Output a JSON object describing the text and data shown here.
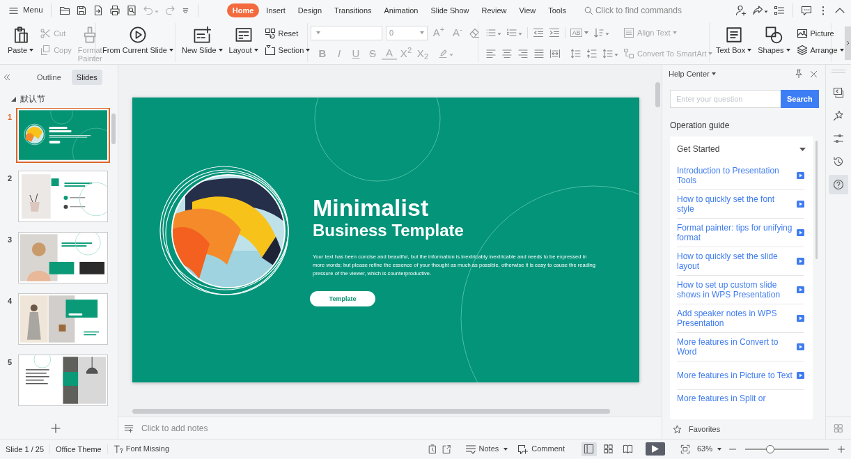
{
  "menu": {
    "label": "Menu"
  },
  "tabs": [
    {
      "label": "Home",
      "selected": true
    },
    {
      "label": "Insert",
      "selected": false
    },
    {
      "label": "Design",
      "selected": false
    },
    {
      "label": "Transitions",
      "selected": false
    },
    {
      "label": "Animation",
      "selected": false
    },
    {
      "label": "Slide Show",
      "selected": false
    },
    {
      "label": "Review",
      "selected": false
    },
    {
      "label": "View",
      "selected": false
    },
    {
      "label": "Tools",
      "selected": false
    }
  ],
  "command_search": {
    "placeholder": "Click to find commands"
  },
  "ribbon_groups": [
    {
      "kind": "buttons",
      "buttons": [
        {
          "label": "Paste",
          "kind": "large",
          "dropdown": true,
          "disabled": false
        },
        {
          "label": "Cut",
          "kind": "small",
          "dropdown": false,
          "disabled": true
        },
        {
          "label": "Copy",
          "kind": "small",
          "dropdown": false,
          "disabled": true
        },
        {
          "label": "Format Painter",
          "kind": "large",
          "dropdown": false,
          "disabled": true
        }
      ]
    },
    {
      "kind": "buttons",
      "buttons": [
        {
          "label": "From Current Slide",
          "kind": "large",
          "dropdown": true,
          "disabled": false
        }
      ]
    },
    {
      "kind": "buttons",
      "buttons": [
        {
          "label": "New Slide",
          "kind": "large",
          "dropdown": true,
          "disabled": false
        },
        {
          "label": "Layout",
          "kind": "large",
          "dropdown": true,
          "disabled": false
        },
        {
          "label": "Reset",
          "kind": "small",
          "dropdown": false,
          "disabled": false
        },
        {
          "label": "Section",
          "kind": "small",
          "dropdown": true,
          "disabled": false
        }
      ]
    },
    {
      "kind": "font",
      "font_size": "0",
      "size_buttons": [
        "A$^{+}$",
        "A$^{-}$"
      ],
      "style_buttons": [
        "B",
        "I",
        "U",
        "S",
        "A",
        "X$^{2}$",
        "X$_{2}$"
      ]
    },
    {
      "kind": "paragraph",
      "direction_label": "AB",
      "buttons": [
        {
          "label": "Align Text",
          "kind": "small",
          "dropdown": true,
          "disabled": true
        },
        {
          "label": "Convert To SmartArt",
          "kind": "small",
          "dropdown": true,
          "disabled": true
        }
      ]
    },
    {
      "kind": "buttons",
      "buttons": [
        {
          "label": "Text Box",
          "kind": "large",
          "dropdown": true,
          "disabled": false
        },
        {
          "label": "Shapes",
          "kind": "large",
          "dropdown": true,
          "disabled": false
        },
        {
          "label": "Picture",
          "kind": "small",
          "dropdown": false,
          "disabled": false
        },
        {
          "label": "Arrange",
          "kind": "small",
          "dropdown": true,
          "disabled": false
        }
      ]
    }
  ],
  "panel_tabs": [
    {
      "label": "Outline",
      "selected": false
    },
    {
      "label": "Slides",
      "selected": true
    }
  ],
  "section": {
    "label": "默认节",
    "expanded": true
  },
  "slides": [
    {
      "number": "1",
      "selected": true
    },
    {
      "number": "2",
      "selected": false
    },
    {
      "number": "3",
      "selected": false
    },
    {
      "number": "4",
      "selected": false
    },
    {
      "number": "5",
      "selected": false
    }
  ],
  "slide": {
    "title": "Minimalist",
    "subtitle": "Business Template",
    "body": "Your text has been concise and beautiful, but the information is inextricably inextricable and needs to be expressed in more words; but please refine the essence of your thought as much as possible, otherwise it is easy to cause the reading pressure of the viewer, which is counterproductive.",
    "button": "Template"
  },
  "notes": {
    "placeholder": "Click to add notes"
  },
  "help_center": {
    "title": "Help Center",
    "search_placeholder": "Enter your question",
    "search_button": "Search",
    "heading": "Operation guide",
    "group": {
      "label": "Get Started",
      "expanded": true
    },
    "articles": [
      "Introduction to Presentation Tools",
      "How to quickly set the font style",
      "Format painter: tips for unifying format",
      "How to quickly set the slide layout",
      "How to set up custom slide shows in WPS Presentation",
      "Add speaker notes in WPS Presentation",
      "More features in Convert to Word",
      "More features in Picture to Text",
      "More features in Split or"
    ],
    "favorites": "Favorites"
  },
  "side_tools": [
    {
      "selected": false
    },
    {
      "selected": false
    },
    {
      "selected": false
    },
    {
      "selected": false
    },
    {
      "selected": true
    }
  ],
  "status_bar": {
    "slide_counter": "Slide 1 / 25",
    "theme": "Office Theme",
    "font_missing": "Font Missing",
    "notes": "Notes",
    "comment": "Comment",
    "views": [
      {
        "selected": true
      },
      {
        "selected": false
      },
      {
        "selected": false
      }
    ],
    "zoom": "63%",
    "zoom_slider": {
      "level": 0.3
    }
  }
}
